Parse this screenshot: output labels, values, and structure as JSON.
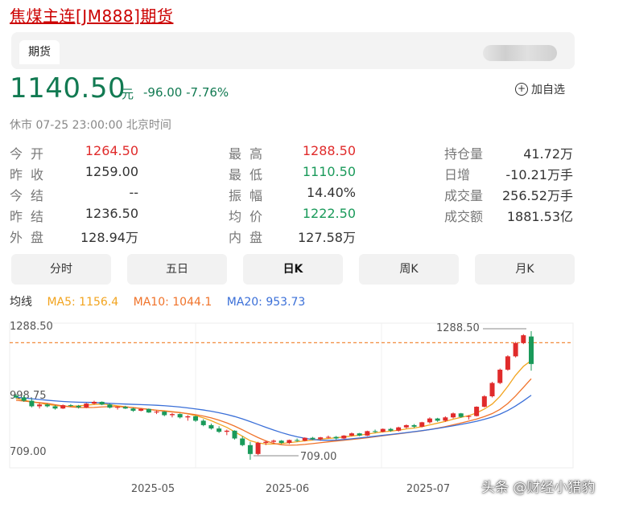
{
  "title": "焦煤主连[JM888]期货",
  "tab": "期货",
  "price": "1140.50",
  "unit": "元",
  "change": "-96.00 -7.76%",
  "add_watch": "加自选",
  "status": "休市  07-25 23:00:00  北京时间",
  "stats": {
    "col1": [
      {
        "label": "今开",
        "value": "1264.50",
        "color": "red"
      },
      {
        "label": "昨收",
        "value": "1259.00",
        "color": ""
      },
      {
        "label": "今结",
        "value": "--",
        "color": ""
      },
      {
        "label": "昨结",
        "value": "1236.50",
        "color": ""
      },
      {
        "label": "外盘",
        "value": "128.94万",
        "color": ""
      }
    ],
    "col2": [
      {
        "label": "最高",
        "value": "1288.50",
        "color": "red"
      },
      {
        "label": "最低",
        "value": "1110.50",
        "color": "green"
      },
      {
        "label": "振幅",
        "value": "14.40%",
        "color": ""
      },
      {
        "label": "均价",
        "value": "1222.50",
        "color": "green"
      },
      {
        "label": "内盘",
        "value": "127.58万",
        "color": ""
      }
    ],
    "col3": [
      {
        "label": "持仓量",
        "value": "41.72万",
        "color": ""
      },
      {
        "label": "日增",
        "value": "-10.21万手",
        "color": ""
      },
      {
        "label": "成交量",
        "value": "256.52万手",
        "color": ""
      },
      {
        "label": "成交额",
        "value": "1881.53亿",
        "color": ""
      }
    ]
  },
  "periods": [
    "分时",
    "五日",
    "日K",
    "周K",
    "月K"
  ],
  "active_period": "日K",
  "ma": {
    "label": "均线",
    "ma5": "MA5: 1156.4",
    "ma10": "MA10: 1044.1",
    "ma20": "MA20: 953.73"
  },
  "colors": {
    "up": "#e02b2b",
    "down": "#1a9a5a",
    "ma5": "#f2a41f",
    "ma10": "#f0732a",
    "ma20": "#3a6fd8",
    "price_green": "#127a52"
  },
  "chart_data": {
    "type": "candlestick",
    "y_labels": [
      "1288.50",
      "998.75",
      "709.00"
    ],
    "x_labels": [
      "2025-05",
      "2025-06",
      "2025-07"
    ],
    "ylim": [
      709.0,
      1288.5
    ],
    "high_annotation": "1288.50",
    "low_annotation": "709.00",
    "current_line": 1236.5,
    "candles": [
      [
        998,
        1005,
        985,
        990
      ],
      [
        990,
        1000,
        970,
        975
      ],
      [
        975,
        985,
        945,
        950
      ],
      [
        950,
        965,
        940,
        958
      ],
      [
        958,
        962,
        945,
        950
      ],
      [
        950,
        955,
        935,
        940
      ],
      [
        940,
        958,
        938,
        955
      ],
      [
        955,
        960,
        948,
        952
      ],
      [
        952,
        956,
        940,
        945
      ],
      [
        945,
        965,
        942,
        962
      ],
      [
        962,
        975,
        958,
        970
      ],
      [
        970,
        972,
        955,
        958
      ],
      [
        958,
        962,
        940,
        944
      ],
      [
        944,
        950,
        935,
        947
      ],
      [
        947,
        952,
        938,
        940
      ],
      [
        940,
        944,
        925,
        930
      ],
      [
        930,
        942,
        927,
        938
      ],
      [
        938,
        940,
        920,
        922
      ],
      [
        922,
        930,
        915,
        926
      ],
      [
        926,
        928,
        905,
        910
      ],
      [
        910,
        920,
        900,
        915
      ],
      [
        915,
        918,
        895,
        900
      ],
      [
        900,
        910,
        885,
        905
      ],
      [
        905,
        908,
        880,
        885
      ],
      [
        885,
        892,
        860,
        865
      ],
      [
        865,
        872,
        845,
        850
      ],
      [
        850,
        860,
        830,
        835
      ],
      [
        835,
        845,
        820,
        840
      ],
      [
        840,
        842,
        800,
        805
      ],
      [
        805,
        815,
        770,
        775
      ],
      [
        775,
        790,
        709,
        735
      ],
      [
        735,
        790,
        730,
        785
      ],
      [
        785,
        795,
        775,
        790
      ],
      [
        790,
        800,
        782,
        795
      ],
      [
        795,
        798,
        780,
        785
      ],
      [
        785,
        800,
        780,
        798
      ],
      [
        798,
        805,
        790,
        795
      ],
      [
        795,
        810,
        792,
        808
      ],
      [
        808,
        812,
        798,
        802
      ],
      [
        802,
        812,
        795,
        810
      ],
      [
        810,
        818,
        805,
        812
      ],
      [
        812,
        816,
        800,
        805
      ],
      [
        805,
        820,
        802,
        818
      ],
      [
        818,
        832,
        815,
        828
      ],
      [
        828,
        830,
        815,
        818
      ],
      [
        818,
        840,
        816,
        838
      ],
      [
        838,
        845,
        830,
        835
      ],
      [
        835,
        850,
        832,
        848
      ],
      [
        848,
        852,
        835,
        840
      ],
      [
        840,
        858,
        836,
        855
      ],
      [
        855,
        868,
        850,
        865
      ],
      [
        865,
        870,
        852,
        858
      ],
      [
        858,
        880,
        855,
        878
      ],
      [
        878,
        900,
        872,
        895
      ],
      [
        895,
        898,
        880,
        885
      ],
      [
        885,
        905,
        880,
        900
      ],
      [
        900,
        922,
        895,
        918
      ],
      [
        918,
        920,
        898,
        902
      ],
      [
        902,
        910,
        890,
        906
      ],
      [
        906,
        950,
        904,
        948
      ],
      [
        948,
        1000,
        945,
        995
      ],
      [
        995,
        1060,
        990,
        1055
      ],
      [
        1055,
        1120,
        1050,
        1115
      ],
      [
        1115,
        1180,
        1110,
        1175
      ],
      [
        1175,
        1240,
        1170,
        1235
      ],
      [
        1235,
        1275,
        1230,
        1270
      ],
      [
        1264.5,
        1288.5,
        1110.5,
        1140.5
      ]
    ],
    "ma5_series": [
      985,
      978,
      970,
      965,
      958,
      954,
      950,
      950,
      952,
      955,
      958,
      960,
      957,
      952,
      948,
      944,
      940,
      936,
      932,
      930,
      926,
      922,
      916,
      908,
      898,
      885,
      870,
      855,
      835,
      815,
      795,
      785,
      780,
      780,
      782,
      786,
      790,
      794,
      798,
      802,
      805,
      808,
      812,
      816,
      820,
      825,
      830,
      835,
      838,
      842,
      848,
      852,
      858,
      866,
      874,
      882,
      892,
      900,
      908,
      920,
      938,
      960,
      995,
      1040,
      1090,
      1130,
      1156
    ]
  }
}
